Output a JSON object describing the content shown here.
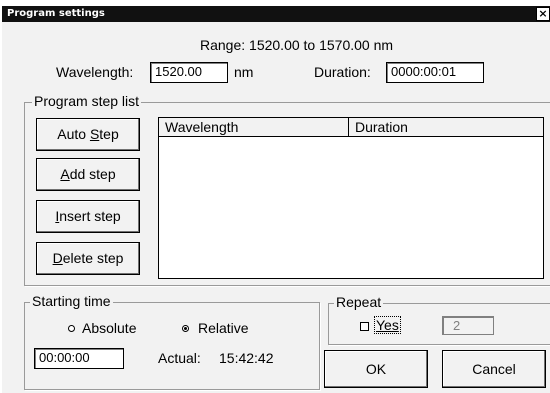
{
  "window": {
    "title": "Program settings",
    "close_glyph": "×"
  },
  "range": {
    "text": "Range:  1520.00 to 1570.00 nm"
  },
  "wavelength": {
    "label": "Wavelength:",
    "value": "1520.00",
    "unit": "nm"
  },
  "duration": {
    "label": "Duration:",
    "value": "0000:00:01"
  },
  "program_list": {
    "legend": "Program step list",
    "columns": [
      "Wavelength",
      "Duration"
    ],
    "rows": []
  },
  "buttons": {
    "auto_step_a": "Auto ",
    "auto_step_u": "S",
    "auto_step_b": "tep",
    "add_step_u": "A",
    "add_step_b": "dd step",
    "insert_step_u": "I",
    "insert_step_b": "nsert step",
    "delete_step_u": "D",
    "delete_step_b": "elete step",
    "ok": "OK",
    "cancel": "Cancel"
  },
  "starting_time": {
    "legend": "Starting time",
    "absolute_label": "Absolute",
    "relative_label": "Relative",
    "selected": "Relative",
    "time_value": "00:00:00",
    "actual_label": "Actual:",
    "actual_value": "15:42:42"
  },
  "repeat": {
    "legend": "Repeat",
    "yes_label": "Yes",
    "yes_checked": false,
    "count_value": "2"
  }
}
